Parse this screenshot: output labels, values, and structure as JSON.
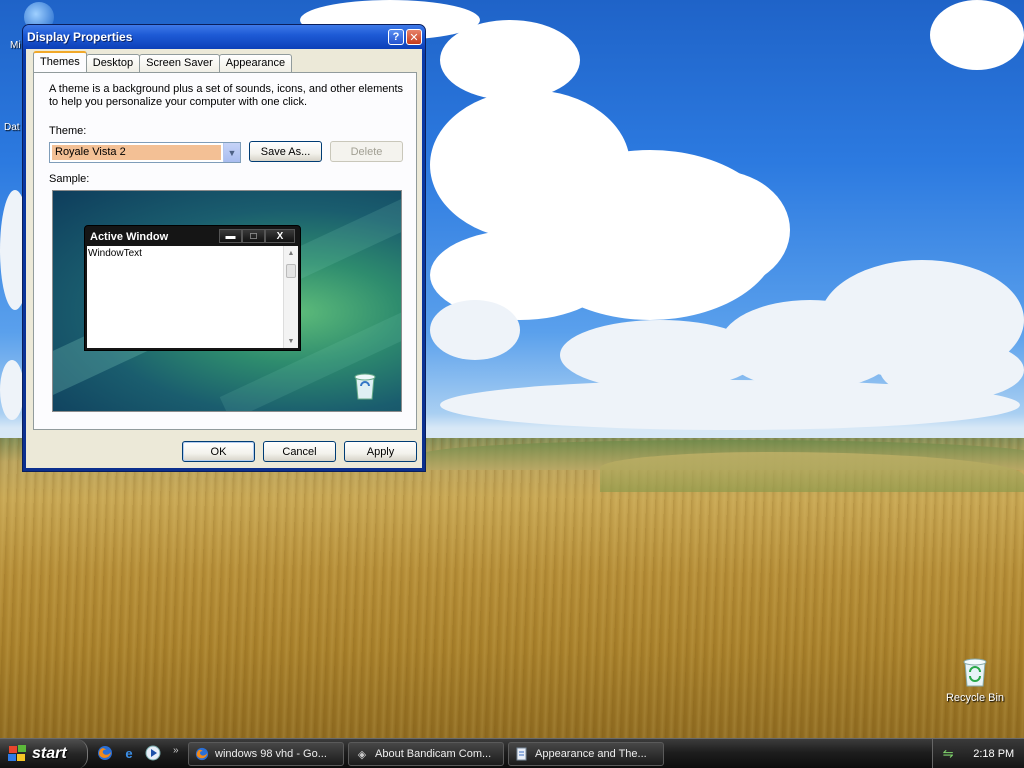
{
  "dialog": {
    "title": "Display Properties",
    "help_glyph": "?",
    "close_glyph": "✕",
    "tabs": [
      {
        "label": "Themes",
        "active": true
      },
      {
        "label": "Desktop",
        "active": false
      },
      {
        "label": "Screen Saver",
        "active": false
      },
      {
        "label": "Appearance",
        "active": false
      }
    ],
    "description": "A theme is a background plus a set of sounds, icons, and other elements to help you personalize your computer with one click.",
    "theme_label": "Theme:",
    "theme_value": "Royale Vista 2",
    "save_as_label": "Save As...",
    "delete_label": "Delete",
    "sample_label": "Sample:",
    "sample": {
      "window_title": "Active Window",
      "window_text": "WindowText",
      "min_glyph": "▬",
      "max_glyph": "□",
      "close_glyph": "X"
    },
    "ok_label": "OK",
    "cancel_label": "Cancel",
    "apply_label": "Apply"
  },
  "desktop": {
    "partial_labels": [
      "Mi",
      "Dat"
    ],
    "recycle_bin_label": "Recycle Bin"
  },
  "taskbar": {
    "start_label": "start",
    "quick_launch": [
      "firefox-icon",
      "ie-icon",
      "media-player-icon"
    ],
    "overflow_glyph": "»",
    "tasks": [
      {
        "label": "windows 98 vhd - Go...",
        "icon": "firefox-icon"
      },
      {
        "label": "About Bandicam Com...",
        "icon": "bandicam-icon"
      },
      {
        "label": "Appearance and The...",
        "icon": "control-panel-icon"
      }
    ],
    "clock": "2:18 PM"
  }
}
